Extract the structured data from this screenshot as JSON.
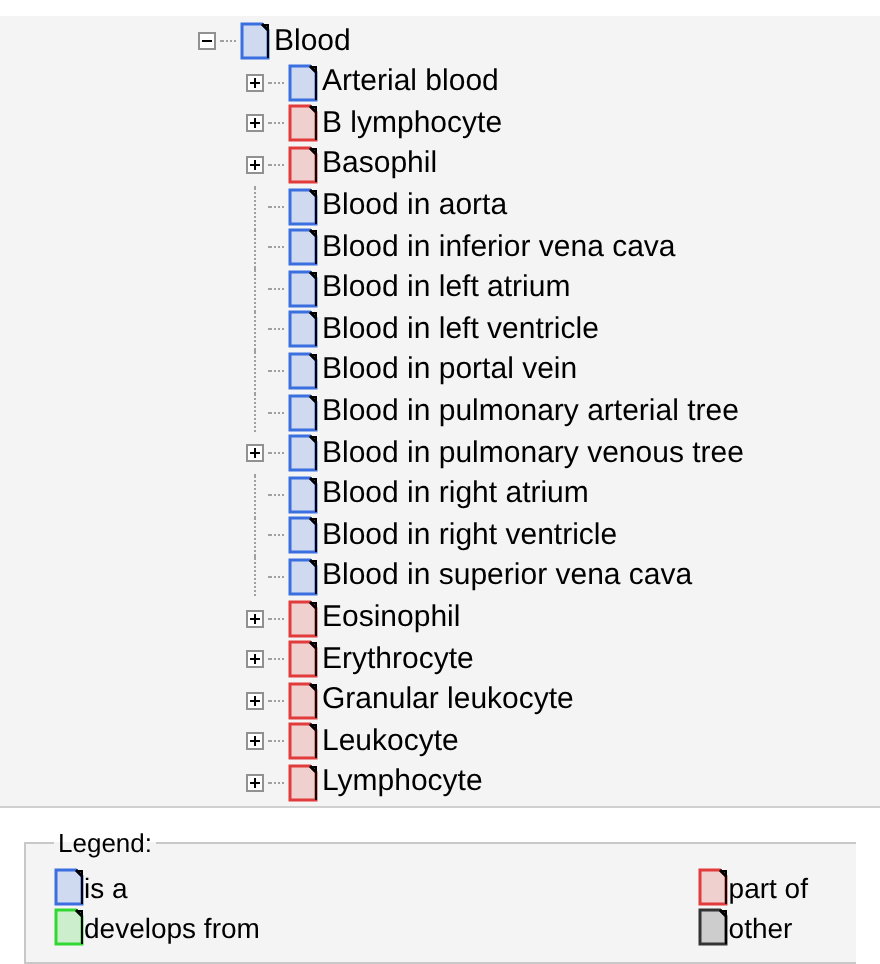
{
  "tree": {
    "label": "Blood",
    "color": "#3b6fe0",
    "expanded": true,
    "children": [
      {
        "label": "Arterial blood",
        "color": "#3b6fe0",
        "expandable": true
      },
      {
        "label": "B lymphocyte",
        "color": "#e23b3b",
        "expandable": true
      },
      {
        "label": "Basophil",
        "color": "#e23b3b",
        "expandable": true
      },
      {
        "label": "Blood in aorta",
        "color": "#3b6fe0",
        "expandable": false
      },
      {
        "label": "Blood in inferior vena cava",
        "color": "#3b6fe0",
        "expandable": false
      },
      {
        "label": "Blood in left atrium",
        "color": "#3b6fe0",
        "expandable": false
      },
      {
        "label": "Blood in left ventricle",
        "color": "#3b6fe0",
        "expandable": false
      },
      {
        "label": "Blood in portal vein",
        "color": "#3b6fe0",
        "expandable": false
      },
      {
        "label": "Blood in pulmonary arterial tree",
        "color": "#3b6fe0",
        "expandable": false
      },
      {
        "label": "Blood in pulmonary venous tree",
        "color": "#3b6fe0",
        "expandable": true
      },
      {
        "label": "Blood in right atrium",
        "color": "#3b6fe0",
        "expandable": false
      },
      {
        "label": "Blood in right ventricle",
        "color": "#3b6fe0",
        "expandable": false
      },
      {
        "label": "Blood in superior vena cava",
        "color": "#3b6fe0",
        "expandable": false
      },
      {
        "label": "Eosinophil",
        "color": "#e23b3b",
        "expandable": true
      },
      {
        "label": "Erythrocyte",
        "color": "#e23b3b",
        "expandable": true
      },
      {
        "label": "Granular leukocyte",
        "color": "#e23b3b",
        "expandable": true
      },
      {
        "label": "Leukocyte",
        "color": "#e23b3b",
        "expandable": true
      },
      {
        "label": "Lymphocyte",
        "color": "#e23b3b",
        "expandable": true
      }
    ]
  },
  "legend": {
    "title": "Legend:",
    "items": [
      {
        "label": "is a",
        "color": "#3b6fe0"
      },
      {
        "label": "part of",
        "color": "#e23b3b"
      },
      {
        "label": "develops from",
        "color": "#32d832"
      },
      {
        "label": "other",
        "color": "#333333"
      }
    ]
  }
}
